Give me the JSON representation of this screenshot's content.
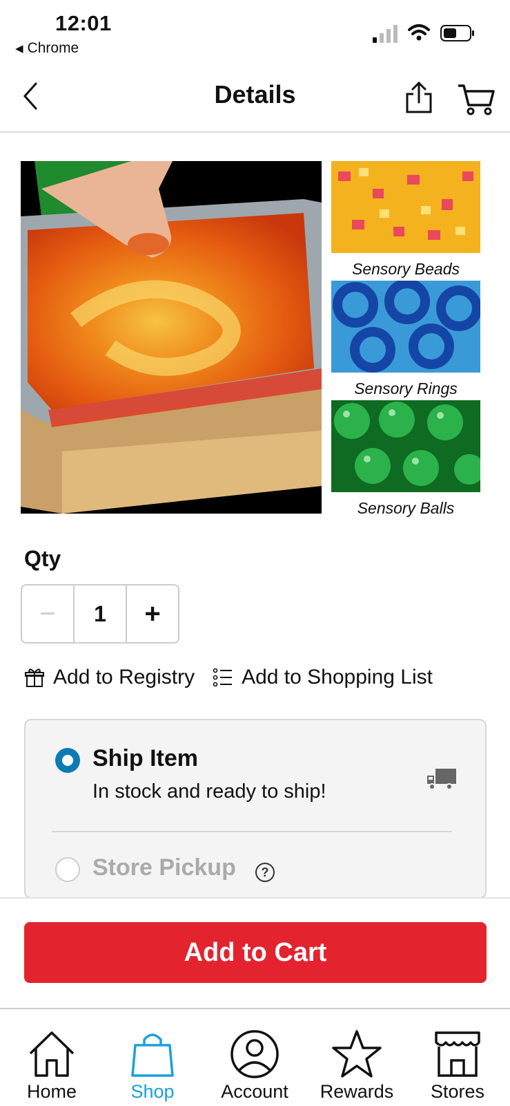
{
  "status_bar": {
    "time": "12:01",
    "back_app": "Chrome"
  },
  "header": {
    "title": "Details"
  },
  "product": {
    "thumbnails": [
      {
        "caption": "Sensory Beads",
        "color": "#f2a11e"
      },
      {
        "caption": "Sensory Rings",
        "color": "#1e6fc8"
      },
      {
        "caption": "Sensory Balls",
        "color": "#1e9a3a"
      }
    ]
  },
  "quantity": {
    "label": "Qty",
    "value": "1",
    "minus": "−",
    "plus": "+"
  },
  "links": {
    "registry": "Add to Registry",
    "shopping_list": "Add to Shopping List"
  },
  "fulfillment": {
    "ship_title": "Ship Item",
    "ship_subtitle": "In stock and ready to ship!",
    "pickup_title": "Store Pickup",
    "help": "?"
  },
  "cart_button": "Add to Cart",
  "tabs": [
    {
      "label": "Home",
      "icon": "home-icon"
    },
    {
      "label": "Shop",
      "icon": "shopping-bag-icon",
      "active": true
    },
    {
      "label": "Account",
      "icon": "account-icon"
    },
    {
      "label": "Rewards",
      "icon": "star-icon"
    },
    {
      "label": "Stores",
      "icon": "store-icon"
    }
  ],
  "colors": {
    "accent": "#1aa0dc",
    "cart_red": "#e3232e",
    "radio_blue": "#0b7bb3"
  }
}
